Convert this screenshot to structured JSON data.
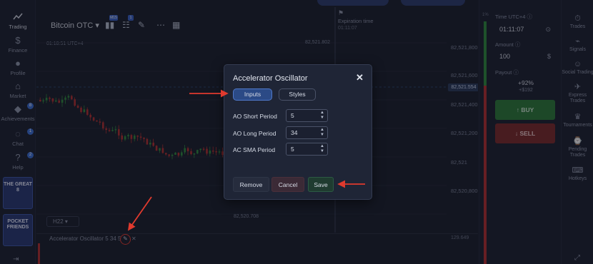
{
  "left_sidebar": {
    "items": [
      {
        "label": "Trading",
        "icon": "trading-chart-icon"
      },
      {
        "label": "Finance",
        "icon": "dollar-icon"
      },
      {
        "label": "Profile",
        "icon": "user-icon"
      },
      {
        "label": "Market",
        "icon": "cart-icon"
      },
      {
        "label": "Achievements",
        "icon": "diamond-icon"
      },
      {
        "label": "Chat",
        "icon": "chat-icon"
      },
      {
        "label": "Help",
        "icon": "help-icon"
      }
    ],
    "achievements_badge": "8",
    "chat_badge": "1",
    "help_badge": "2",
    "promo_1": "THE GREAT 8",
    "promo_2": "POCKET FRIENDS"
  },
  "chart": {
    "asset": "Bitcoin OTC ▾",
    "toolbar_badge_1": "M15",
    "toolbar_badge_2": "1",
    "clock": "01:10:51 UTC+4",
    "expiration_title": "Expiration time",
    "expiration_value": "01:11:07",
    "timeframe": "H22",
    "price_in_chart_top": "82,521.802",
    "price_in_chart_bottom": "82,520.708",
    "price_labels": [
      "82,521,800",
      "82,521,600",
      "82,521,400",
      "82,521,200",
      "82,521",
      "82,520,800"
    ],
    "current_price": "82,521.554",
    "indicator_label": "Accelerator Oscillator 5 34 5",
    "indicator_value": "129.649",
    "pct_mark": "1%"
  },
  "trade_panel": {
    "time_label": "Time UTC+4 ⓘ",
    "time_value": "01:11:07",
    "amount_label": "Amount ⓘ",
    "amount_value": "100",
    "payout_label": "Payout ⓘ",
    "payout_pct": "+92%",
    "payout_amount": "+$192",
    "buy": "BUY",
    "sell": "SELL",
    "colors": {
      "buy": "#2c7a3a",
      "sell": "#7a2a2a"
    }
  },
  "right_sidebar": {
    "items": [
      {
        "label": "Trades",
        "icon": "trades-icon"
      },
      {
        "label": "Signals",
        "icon": "signals-icon"
      },
      {
        "label": "Social Trading",
        "icon": "social-icon"
      },
      {
        "label": "Express Trades",
        "icon": "express-icon"
      },
      {
        "label": "Tournaments",
        "icon": "trophy-icon"
      },
      {
        "label": "Pending Trades",
        "icon": "pending-icon"
      },
      {
        "label": "Hotkeys",
        "icon": "keyboard-icon"
      }
    ]
  },
  "modal": {
    "title": "Accelerator Oscillator",
    "tabs": [
      "Inputs",
      "Styles"
    ],
    "fields": [
      {
        "label": "AO Short Period",
        "value": "5"
      },
      {
        "label": "AO Long Period",
        "value": "34"
      },
      {
        "label": "AC SMA Period",
        "value": "5"
      }
    ],
    "buttons": {
      "remove": "Remove",
      "cancel": "Cancel",
      "save": "Save"
    }
  }
}
